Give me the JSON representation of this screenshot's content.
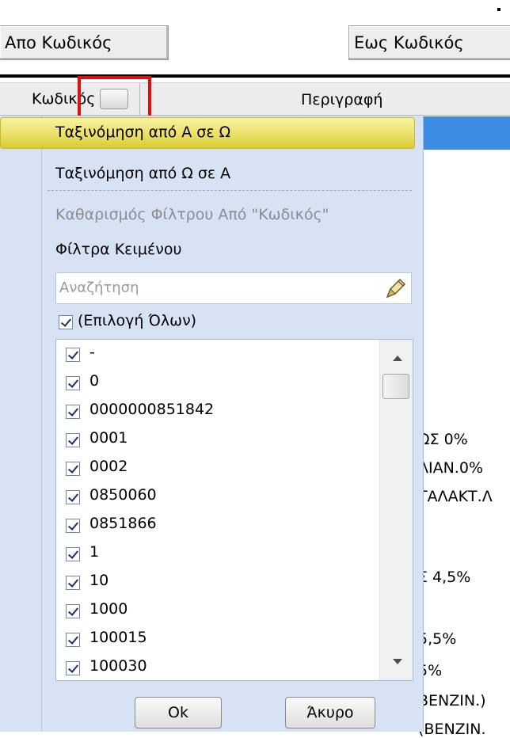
{
  "top": {
    "from_label": "Απο Κωδικός",
    "to_label": "Εως Κωδικός",
    "dot": "."
  },
  "grid": {
    "columns": [
      "Κωδικός",
      "Περιγραφή"
    ]
  },
  "background_text": [
    "ΩΣ 0%",
    "ΛΙΑΝ.0%",
    "ΤΑΛΑΚΤ.Λ",
    "Σ 4,5%",
    "5,5%",
    "5%",
    "BENZIN.)",
    "(BENZIN."
  ],
  "menu": {
    "sort_asc": "Ταξινόμηση από Α σε Ω",
    "sort_desc": "Ταξινόμηση από Ω σε Α",
    "clear_filter": "Καθαρισμός Φίλτρου Από \"Κωδικός\"",
    "text_filters": "Φίλτρα Κειμένου"
  },
  "search": {
    "placeholder": "Αναζήτηση"
  },
  "select_all": "(Επιλογή Όλων)",
  "items": [
    "-",
    "0",
    "0000000851842",
    "0001",
    "0002",
    "0850060",
    "0851866",
    "1",
    "10",
    "1000",
    "100015",
    "100030"
  ],
  "buttons": {
    "ok": "Ok",
    "cancel": "Άκυρο"
  },
  "colors": {
    "highlight": "#ece06a",
    "popup_bg": "#d7e3f5",
    "selection": "#3b8de4",
    "red_box": "#e01010"
  }
}
